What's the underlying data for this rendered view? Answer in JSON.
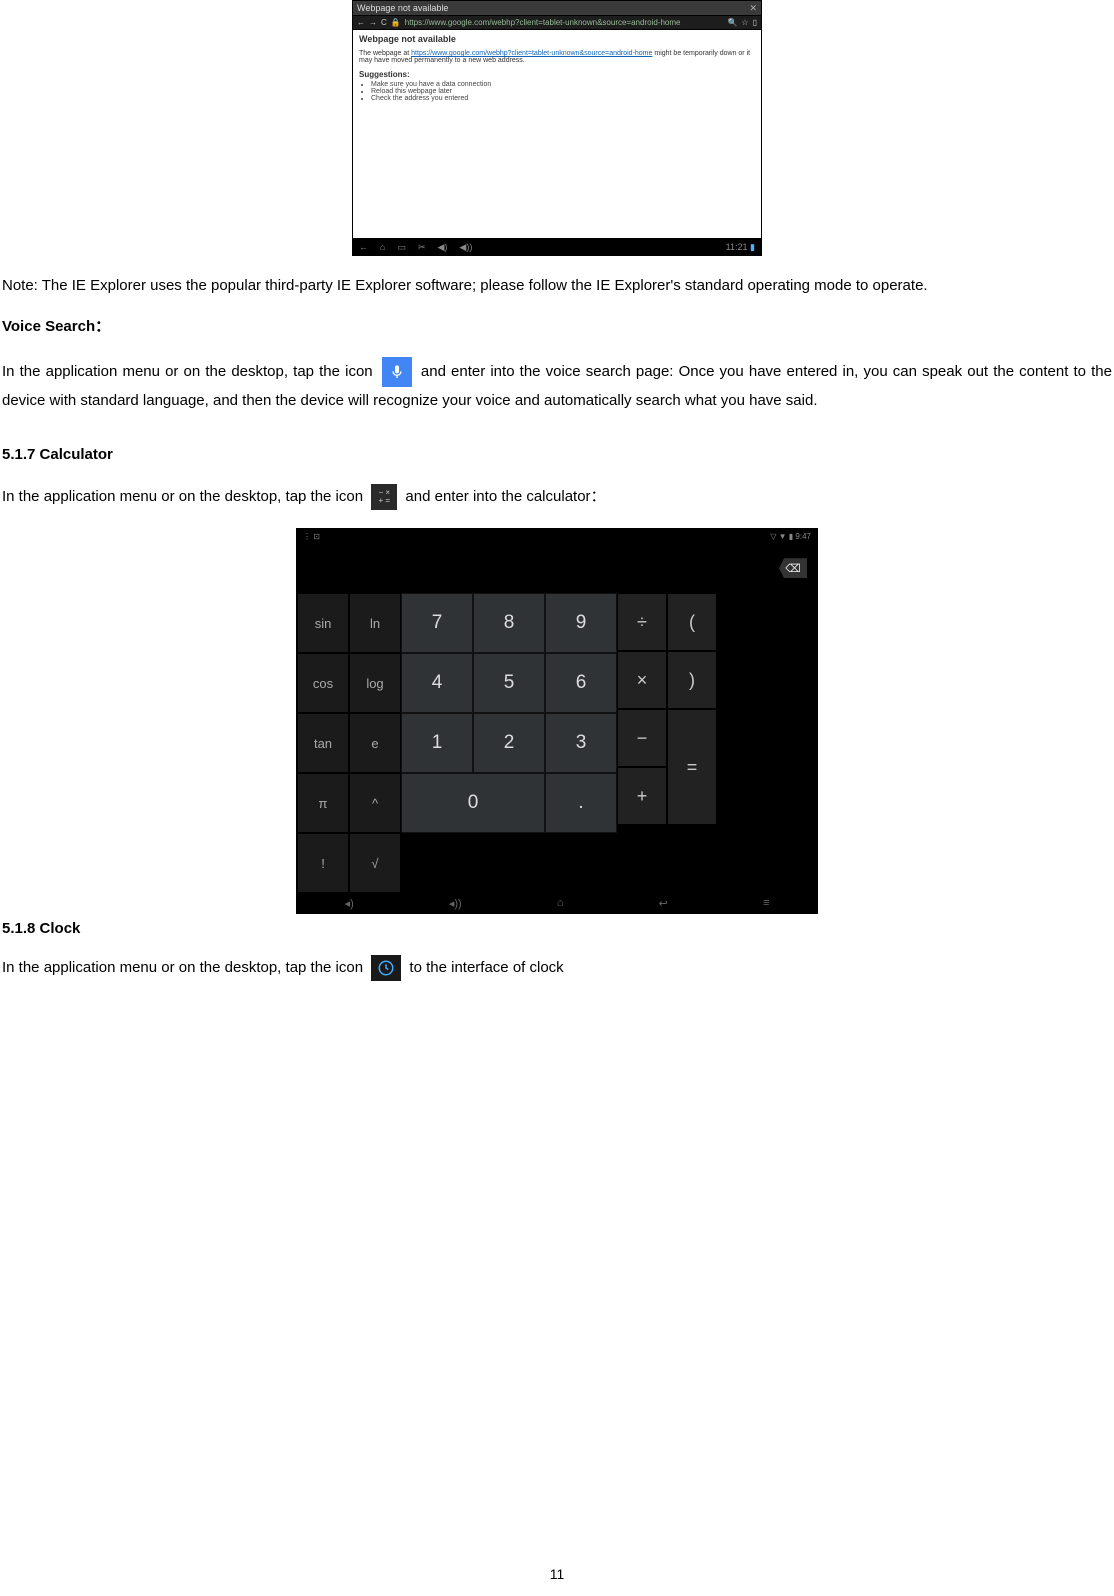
{
  "page_number": "11",
  "browser_screenshot": {
    "tab_title": "Webpage not available",
    "url_prefix": "https://www.google.com/webhp?client=tablet-unknown&source=android-home",
    "error_heading": "Webpage not available",
    "error_body_prefix": "The webpage at",
    "error_url": "https://www.google.com/webhp?client=tablet-unknown&source=android-home",
    "error_body_suffix": "might be temporarily down or it may have moved permanently to a new web address.",
    "suggestions_label": "Suggestions:",
    "suggestions": [
      "Make sure you have a data connection",
      "Reload this webpage later",
      "Check the address you entered"
    ],
    "nav_time": "11:21"
  },
  "note_text": "Note: The IE Explorer uses the popular third-party IE Explorer software; please follow the IE Explorer's standard operating mode to operate.",
  "voice_search": {
    "heading": "Voice Search：",
    "text_before_icon": "In the application menu or on the desktop, tap the icon",
    "text_after_icon": "and enter into the voice search page: Once you have entered in, you can speak out the content to the device with standard language, and then the device will recognize your voice and automatically search what you have said."
  },
  "calculator": {
    "heading": "5.1.7 Calculator",
    "text_before_icon": "In the application menu or on the desktop, tap the icon",
    "text_after_icon": "and enter into the calculator：",
    "status_time": "9:47",
    "funcs": [
      "sin",
      "ln",
      "cos",
      "log",
      "tan",
      "e",
      "π",
      "^",
      "!",
      "√"
    ],
    "nums": [
      "7",
      "8",
      "9",
      "4",
      "5",
      "6",
      "1",
      "2",
      "3",
      "0",
      "."
    ],
    "ops": {
      "div": "÷",
      "lp": "(",
      "mul": "×",
      "rp": ")",
      "sub": "−",
      "eq": "=",
      "add": "+"
    },
    "backspace_label": "⌫"
  },
  "clock": {
    "heading": "5.1.8 Clock",
    "text_before_icon": "In the application menu or on the desktop, tap the icon",
    "text_after_icon": "to the interface of clock"
  }
}
